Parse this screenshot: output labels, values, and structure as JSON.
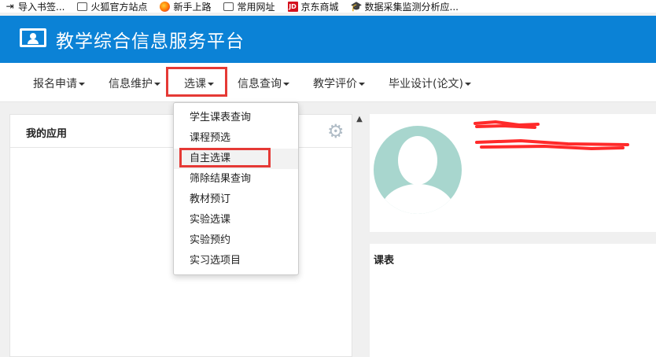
{
  "bookmarks": [
    {
      "icon": "import-icon",
      "label": "导入书签..."
    },
    {
      "icon": "folder-icon",
      "label": "火狐官方站点"
    },
    {
      "icon": "firefox-icon",
      "label": "新手上路"
    },
    {
      "icon": "folder-icon",
      "label": "常用网址"
    },
    {
      "icon": "jd-icon",
      "label": "京东商城"
    },
    {
      "icon": "graduation-cap-icon",
      "label": "数据采集监测分析应..."
    }
  ],
  "header": {
    "title": "教学综合信息服务平台"
  },
  "nav": [
    {
      "label": "报名申请"
    },
    {
      "label": "信息维护"
    },
    {
      "label": "选课"
    },
    {
      "label": "信息查询"
    },
    {
      "label": "教学评价"
    },
    {
      "label": "毕业设计(论文)"
    }
  ],
  "dropdown": [
    {
      "label": "学生课表查询"
    },
    {
      "label": "课程预选"
    },
    {
      "label": "自主选课"
    },
    {
      "label": "筛除结果查询"
    },
    {
      "label": "教材预订"
    },
    {
      "label": "实验选课"
    },
    {
      "label": "实验预约"
    },
    {
      "label": "实习选项目"
    }
  ],
  "panels": {
    "my_apps": {
      "title": "我的应用"
    },
    "schedule": {
      "title": "课表"
    }
  },
  "colors": {
    "header_bg": "#0b82d6",
    "highlight_border": "#e53935",
    "avatar_bg": "#a8d6ce",
    "redaction": "#ff2a2a"
  }
}
